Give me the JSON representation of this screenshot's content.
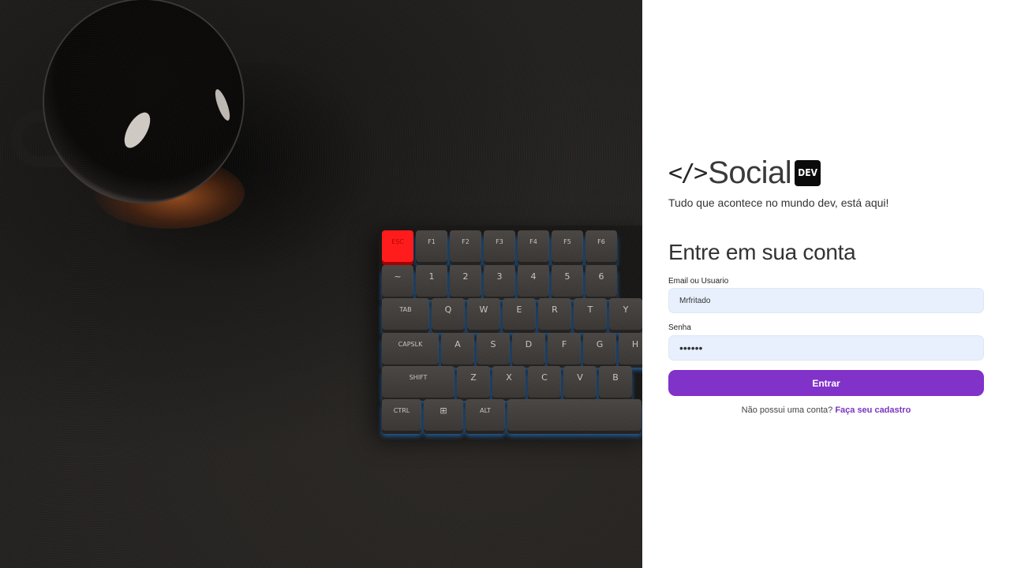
{
  "brand": {
    "code_icon": "</>",
    "name": "Social",
    "badge": "DEV",
    "tagline": "Tudo que acontece no mundo dev, está aqui!"
  },
  "login": {
    "title": "Entre em sua conta",
    "email_label": "Email ou Usuario",
    "email_value": "Mrfritado",
    "password_label": "Senha",
    "password_value": "••••••",
    "submit_label": "Entrar",
    "signup_prompt": "Não possui uma conta?",
    "signup_link": "Faça seu cadastro"
  },
  "colors": {
    "accent": "#8132c9",
    "link": "#7a35c2",
    "input_bg": "#e8f0fe"
  },
  "keyboard": {
    "rows": [
      [
        "ESC",
        "F1",
        "F2",
        "F3",
        "F4",
        "F5",
        "F6"
      ],
      [
        "~",
        "1",
        "2",
        "3",
        "4",
        "5",
        "6"
      ],
      [
        "TAB",
        "Q",
        "W",
        "E",
        "R",
        "T",
        "Y"
      ],
      [
        "CAPSLK",
        "A",
        "S",
        "D",
        "F",
        "G",
        "H"
      ],
      [
        "SHIFT",
        "Z",
        "X",
        "C",
        "V",
        "B"
      ],
      [
        "CTRL",
        "⊞",
        "ALT",
        ""
      ]
    ]
  }
}
